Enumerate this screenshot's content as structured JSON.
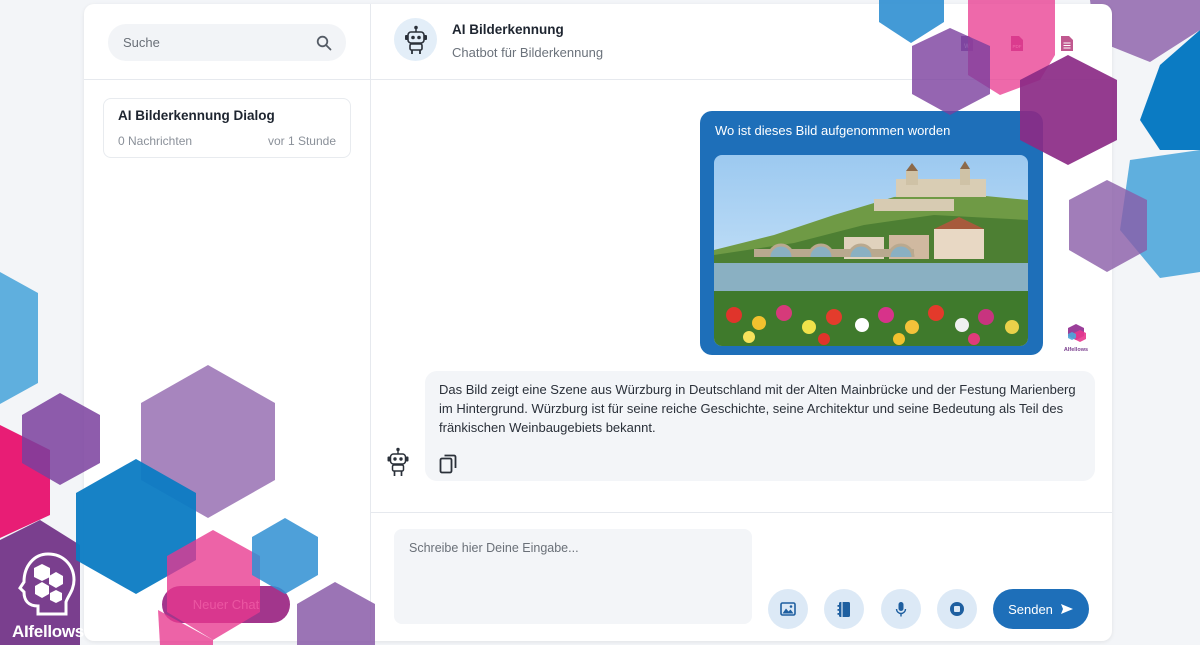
{
  "sidebar": {
    "search": {
      "placeholder": "Suche"
    },
    "chats": [
      {
        "title": "AI Bilderkennung Dialog",
        "count": "0 Nachrichten",
        "time": "vor 1 Stunde"
      }
    ],
    "new_chat_label": "Neuer Chat"
  },
  "header": {
    "bot_name": "AI Bilderkennung",
    "bot_subtitle": "Chatbot für Bilderkennung",
    "export_icons": [
      "word-doc-icon",
      "pdf-doc-icon",
      "text-doc-icon"
    ]
  },
  "messages": [
    {
      "role": "user",
      "text": "Wo ist dieses Bild aufgenommen worden"
    },
    {
      "role": "bot",
      "text": "Das Bild zeigt eine Szene aus Würzburg in Deutschland mit der Alten Mainbrücke und der Festung Marienberg im Hintergrund. Würzburg ist für seine reiche Geschichte, seine Architektur und seine Bedeutung als Teil des fränkischen Weinbaugebiets bekannt."
    }
  ],
  "composer": {
    "placeholder": "Schreibe hier Deine Eingabe...",
    "send_label": "Senden",
    "action_icons": [
      "image-icon",
      "notebook-icon",
      "microphone-icon",
      "stop-icon"
    ]
  },
  "brand": {
    "name": "AIfellows"
  },
  "colors": {
    "primary_blue": "#1e6fb9",
    "magenta": "#a2368c",
    "pink": "#e8378e",
    "purple": "#8a5ca8",
    "light_blue": "#4fa7da"
  }
}
